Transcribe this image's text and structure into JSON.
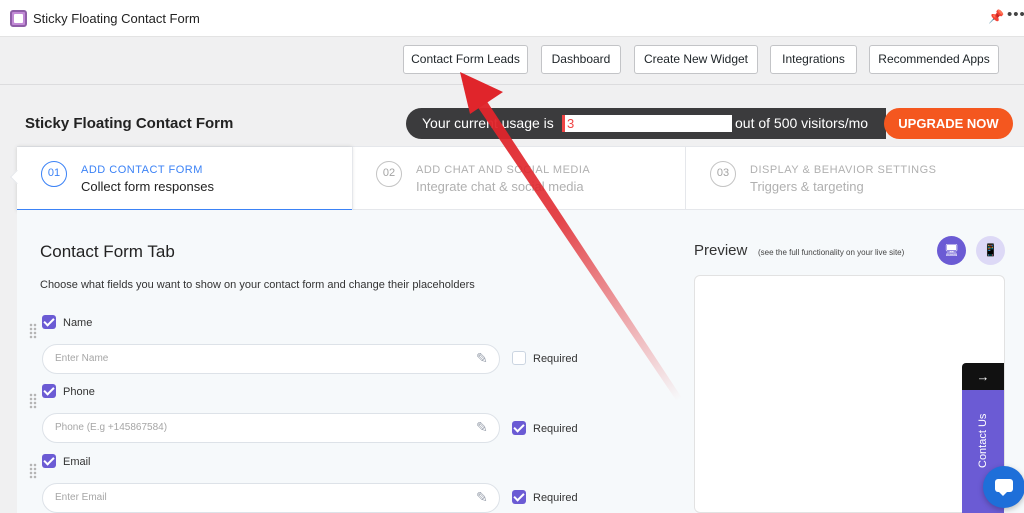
{
  "topbar": {
    "title": "Sticky Floating Contact Form",
    "pin_icon": "pin-icon",
    "more_icon": "more-icon",
    "more_glyph": "•••"
  },
  "nav": {
    "buttons": [
      {
        "label": "Contact Form Leads"
      },
      {
        "label": "Dashboard"
      },
      {
        "label": "Create New Widget"
      },
      {
        "label": "Integrations"
      },
      {
        "label": "Recommended Apps"
      }
    ]
  },
  "header": {
    "title": "Sticky Floating Contact Form",
    "usage_prefix": "Your current usage is",
    "usage_value": "3",
    "usage_suffix": "out of 500 visitors/mo",
    "upgrade_label": "UPGRADE NOW"
  },
  "steps": [
    {
      "num": "01",
      "title": "ADD CONTACT FORM",
      "subtitle": "Collect form responses",
      "active": true
    },
    {
      "num": "02",
      "title": "ADD CHAT AND SOCIAL MEDIA",
      "subtitle": "Integrate chat & social media",
      "active": false
    },
    {
      "num": "03",
      "title": "DISPLAY & BEHAVIOR SETTINGS",
      "subtitle": "Triggers & targeting",
      "active": false
    }
  ],
  "form": {
    "title": "Contact Form Tab",
    "description": "Choose what fields you want to show on your contact form and change their placeholders",
    "required_label": "Required",
    "fields": [
      {
        "label": "Name",
        "placeholder": "Enter Name",
        "enabled": true,
        "required": false
      },
      {
        "label": "Phone",
        "placeholder": "Phone (E.g +145867584)",
        "enabled": true,
        "required": true
      },
      {
        "label": "Email",
        "placeholder": "Enter Email",
        "enabled": true,
        "required": true
      }
    ]
  },
  "preview": {
    "title": "Preview",
    "note": "(see the full functionality on your live site)",
    "contact_tab_label": "Contact Us",
    "arrow_glyph": "→"
  },
  "colors": {
    "accent": "#6b5bd4",
    "step_active": "#3b82f6",
    "upgrade": "#f4571f",
    "annotation_arrow": "#e0252b"
  }
}
